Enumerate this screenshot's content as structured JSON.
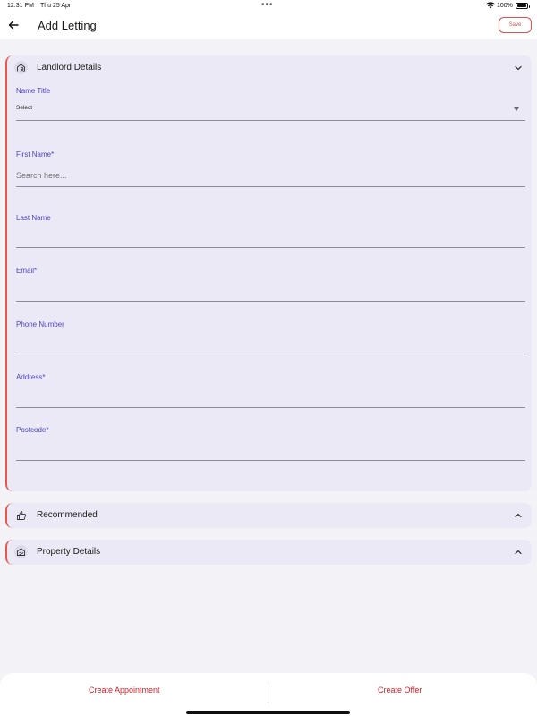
{
  "status_bar": {
    "time": "12:31 PM",
    "date": "Thu 25 Apr",
    "battery_pct": "100%"
  },
  "header": {
    "title": "Add Letting",
    "save_label": "Save"
  },
  "landlord": {
    "title": "Landlord Details",
    "fields": {
      "name_title": {
        "label": "Name Title",
        "value": "Select"
      },
      "first_name": {
        "label": "First Name*",
        "placeholder": "Search here..."
      },
      "last_name": {
        "label": "Last Name"
      },
      "email": {
        "label": "Email*"
      },
      "phone": {
        "label": "Phone Number"
      },
      "address": {
        "label": "Address*"
      },
      "postcode": {
        "label": "Postcode*"
      }
    }
  },
  "recommended": {
    "title": "Recommended"
  },
  "property": {
    "title": "Property Details"
  },
  "bottom": {
    "create_appointment": "Create Appointment",
    "create_offer": "Create Offer"
  },
  "colors": {
    "accent_red": "#e8574a",
    "label_blue": "#4a45c8",
    "card_bg": "#ebe9f5",
    "page_bg": "#f3f2f7",
    "action_red": "#cc1f2a"
  }
}
